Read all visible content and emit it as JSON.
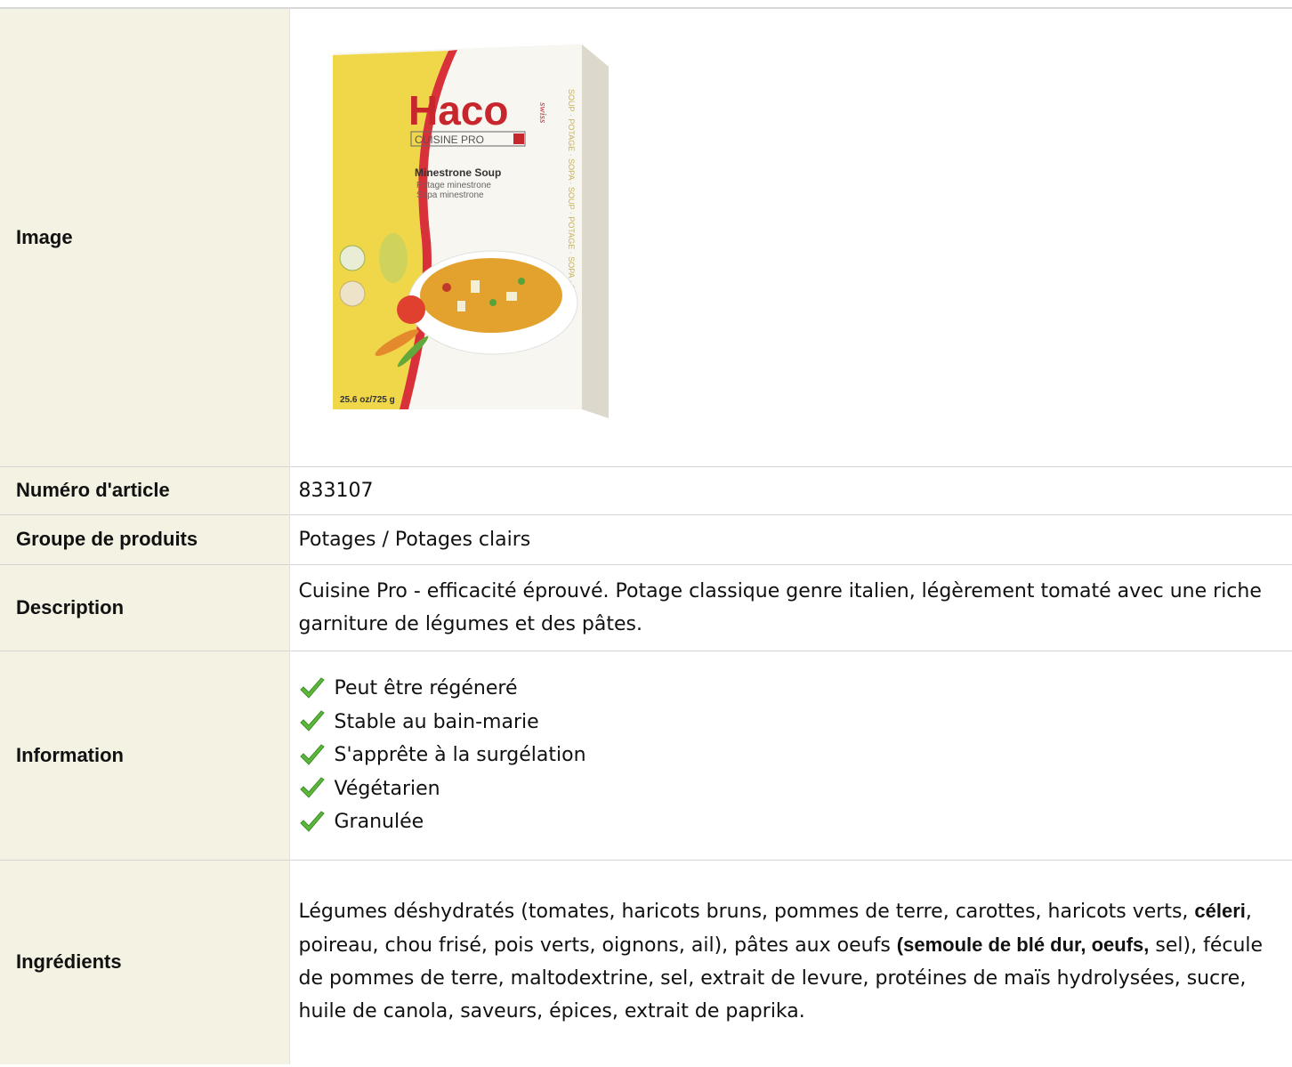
{
  "rows": {
    "image": {
      "label": "Image"
    },
    "article": {
      "label": "Numéro d'article",
      "value": "833107"
    },
    "group": {
      "label": "Groupe de produits",
      "value": "Potages / Potages clairs"
    },
    "description": {
      "label": "Description",
      "value": "Cuisine Pro - efficacité éprouvé. Potage classique genre italien, légèrement tomaté avec une riche garniture de légumes et des pâtes."
    },
    "information": {
      "label": "Information",
      "items": [
        "Peut être régéneré",
        "Stable au bain-marie",
        "S'apprête à la surgélation",
        "Végétarien",
        "Granulée"
      ]
    },
    "ingredients": {
      "label": "Ingrédients",
      "segments": [
        {
          "text": "Légumes déshydratés (tomates, haricots bruns, pommes de terre, carottes, haricots verts, ",
          "bold": false
        },
        {
          "text": "céleri",
          "bold": true
        },
        {
          "text": ", poireau, chou frisé, pois verts, oignons, ail), pâtes aux oeufs ",
          "bold": false
        },
        {
          "text": "(semoule de blé dur, oeufs,",
          "bold": true
        },
        {
          "text": " sel), fécule de pommes de terre, maltodextrine, sel, extrait de levure, protéines de maïs hydrolysées, sucre, huile de canola, saveurs, épices, extrait de paprika.",
          "bold": false
        }
      ]
    }
  },
  "package": {
    "brand": "Haco",
    "brand_suffix": "swiss",
    "line": "CUISINE PRO",
    "name_en": "Minestrone Soup",
    "name_fr": "Potage minestrone",
    "name_es": "Sopa minestrone",
    "weight": "25.6 oz/725 g",
    "side_text": "SOUP · POTAGE · SOPA · SOUP · POTAGE · SOPA · SOUP"
  },
  "colors": {
    "label_bg": "#f4f2e2",
    "border": "#d4d4d4",
    "check_green": "#5cb83a",
    "brand_red": "#c8262d"
  }
}
